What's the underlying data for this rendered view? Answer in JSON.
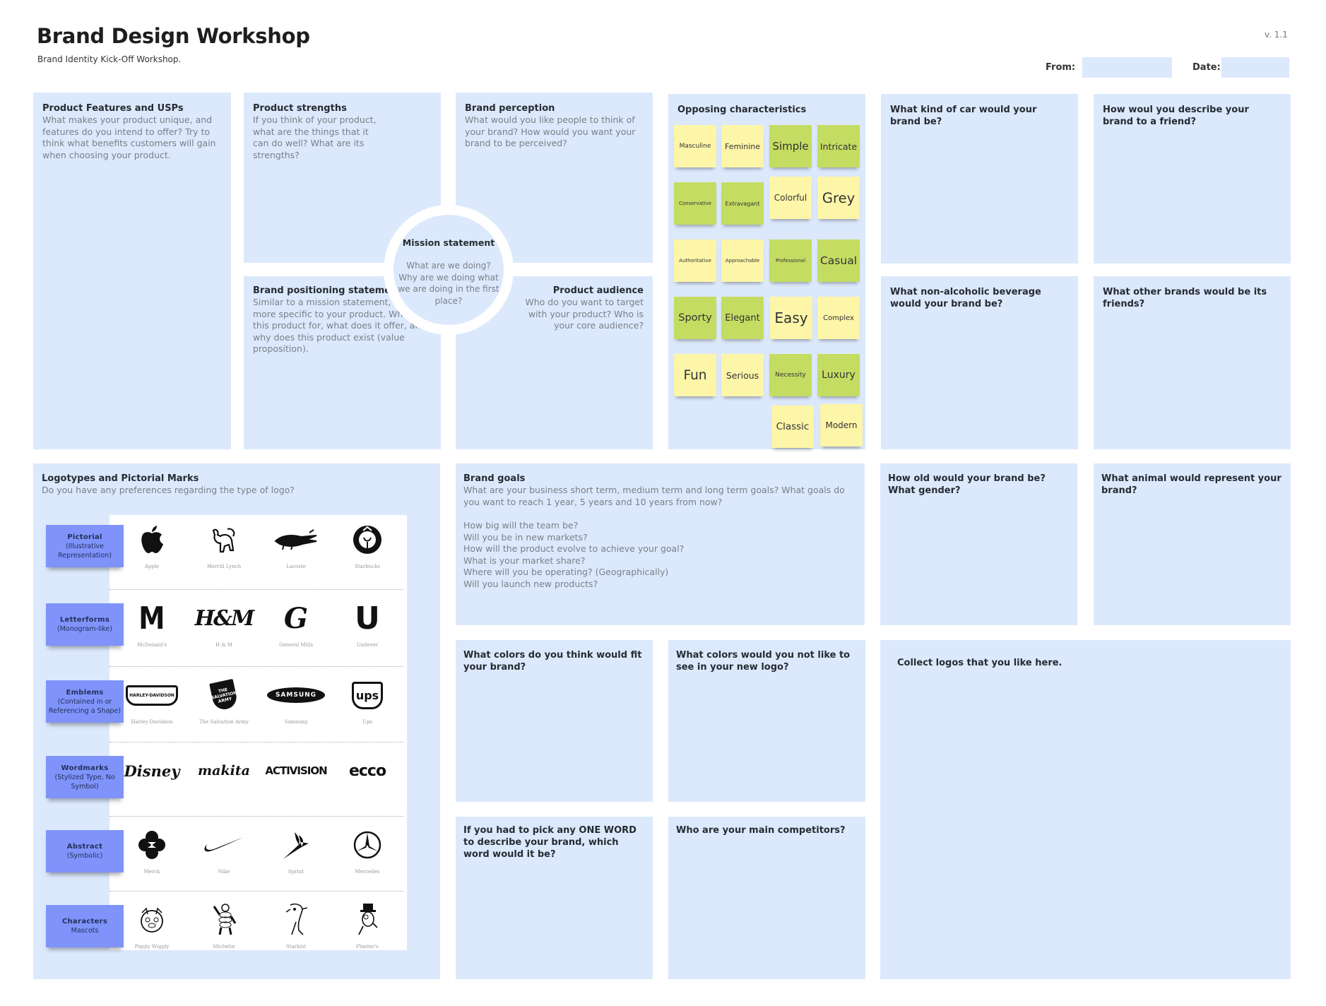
{
  "header": {
    "title": "Brand Design Workshop",
    "subtitle": "Brand Identity Kick-Off Workshop.",
    "version": "v. 1.1",
    "from_label": "From:",
    "from_value": "",
    "date_label": "Date:",
    "date_value": ""
  },
  "panels": {
    "features": {
      "title": "Product Features and USPs",
      "desc": "What makes your product unique, and features do you intend to offer? Try to think what benefits customers will gain when choosing your product."
    },
    "strengths": {
      "title": "Product strengths",
      "desc": "If you think of your product, what are the things that it can do well? What are its strengths?"
    },
    "perception": {
      "title": "Brand perception",
      "desc": "What would you like people to think of your brand? How would you want your brand to be perceived?"
    },
    "positioning": {
      "title": "Brand positioning statement",
      "desc": "Similar to a mission statement, but more specific to your product. Who is this product for, what does it offer, and why does this product exist (value proposition)."
    },
    "audience": {
      "title": "Product audience",
      "desc": "Who do you want to target with your product? Who is your core audience?"
    },
    "mission": {
      "title": "Mission statement",
      "desc": "What are we doing? Why are we doing what we are doing in the first place?"
    },
    "opposing": {
      "title": "Opposing characteristics"
    },
    "car": {
      "title": "What kind of car would your brand be?"
    },
    "describe": {
      "title": "How woul you describe your brand to a friend?"
    },
    "beverage": {
      "title": "What non-alcoholic beverage would your brand be?"
    },
    "friends": {
      "title": "What other brands would be its friends?"
    },
    "logotypes": {
      "title": "Logotypes and Pictorial Marks",
      "desc": "Do you have any preferences regarding the type of logo?"
    },
    "goals": {
      "title": "Brand goals",
      "desc": "What are your business short term, medium term and long term goals? What goals do you want to reach 1 year, 5 years and 10 years from now?",
      "questions": [
        "How big will the team be?",
        "Will you be in new markets?",
        "How will the product evolve to achieve your goal?",
        "What is your market share?",
        "Where will you be operating? (Geographically)",
        "Will you launch new products?"
      ]
    },
    "age": {
      "title": "How old would your brand be? What gender?"
    },
    "animal": {
      "title": "What animal would represent your brand?"
    },
    "colors_fit": {
      "title": "What colors do you think would fit your brand?"
    },
    "colors_not": {
      "title": "What colors would you not like to see in your new logo?"
    },
    "collect": {
      "title": "Collect logos that you like here."
    },
    "one_word": {
      "title": "If you had to pick any ONE WORD to describe your brand, which word would it be?"
    },
    "competitors": {
      "title": "Who are your main competitors?"
    }
  },
  "stickies": [
    {
      "label": "Masculine",
      "color": "yellow"
    },
    {
      "label": "Feminine",
      "color": "yellow"
    },
    {
      "label": "Simple",
      "color": "green"
    },
    {
      "label": "Intricate",
      "color": "green"
    },
    {
      "label": "Conservative",
      "color": "green"
    },
    {
      "label": "Extravagant",
      "color": "green"
    },
    {
      "label": "Colorful",
      "color": "yellow"
    },
    {
      "label": "Grey",
      "color": "yellow"
    },
    {
      "label": "Authoritative",
      "color": "yellow"
    },
    {
      "label": "Approachable",
      "color": "yellow"
    },
    {
      "label": "Professional",
      "color": "green"
    },
    {
      "label": "Casual",
      "color": "green"
    },
    {
      "label": "Sporty",
      "color": "green"
    },
    {
      "label": "Elegant",
      "color": "green"
    },
    {
      "label": "Easy",
      "color": "yellow"
    },
    {
      "label": "Complex",
      "color": "yellow"
    },
    {
      "label": "Fun",
      "color": "yellow"
    },
    {
      "label": "Serious",
      "color": "yellow"
    },
    {
      "label": "Necessity",
      "color": "green"
    },
    {
      "label": "Luxury",
      "color": "green"
    },
    {
      "label": "Classic",
      "color": "yellow"
    },
    {
      "label": "Modern",
      "color": "yellow"
    }
  ],
  "logo_categories": [
    {
      "name": "Pictorial",
      "sub": "(Illustrative Representation)",
      "logos": [
        {
          "name": "Apple",
          "icon": "apple-logo"
        },
        {
          "name": "Merrill Lynch",
          "icon": "bull-logo"
        },
        {
          "name": "Lacoste",
          "icon": "crocodile-logo"
        },
        {
          "name": "Starbucks",
          "icon": "siren-logo"
        }
      ]
    },
    {
      "name": "Letterforms",
      "sub": "(Monogram-like)",
      "logos": [
        {
          "name": "McDonald's",
          "icon": "golden-arches-logo",
          "glyph": "M"
        },
        {
          "name": "H & M",
          "icon": "hm-logo",
          "glyph": "H&M"
        },
        {
          "name": "General Mills",
          "icon": "g-logo",
          "glyph": "G"
        },
        {
          "name": "Unilever",
          "icon": "u-logo",
          "glyph": "U"
        }
      ]
    },
    {
      "name": "Emblems",
      "sub": "(Contained in or Referencing a Shape)",
      "logos": [
        {
          "name": "Harley-Davidson",
          "icon": "harley-shield-logo",
          "glyph": "HARLEY-DAVIDSON"
        },
        {
          "name": "The Salvation Army",
          "icon": "salvation-shield-logo",
          "glyph": "THE SALVATION ARMY"
        },
        {
          "name": "Samsung",
          "icon": "samsung-ellipse-logo",
          "glyph": "SAMSUNG"
        },
        {
          "name": "Ups",
          "icon": "ups-shield-logo",
          "glyph": "ups"
        }
      ]
    },
    {
      "name": "Wordmarks",
      "sub": "(Stylized Type, No Symbol)",
      "logos": [
        {
          "name": "",
          "icon": "disney-wordmark",
          "glyph": "Disney"
        },
        {
          "name": "",
          "icon": "makita-wordmark",
          "glyph": "makita"
        },
        {
          "name": "",
          "icon": "activision-wordmark",
          "glyph": "ACTIVISION"
        },
        {
          "name": "",
          "icon": "ecco-wordmark",
          "glyph": "ecco"
        }
      ]
    },
    {
      "name": "Abstract",
      "sub": "(Symbolic)",
      "logos": [
        {
          "name": "Merck",
          "icon": "merck-logo"
        },
        {
          "name": "Nike",
          "icon": "swoosh-logo"
        },
        {
          "name": "Sprint",
          "icon": "sprint-logo"
        },
        {
          "name": "Mercedes",
          "icon": "mercedes-star-logo"
        }
      ]
    },
    {
      "name": "Characters",
      "sub": "Mascots",
      "logos": [
        {
          "name": "Piggly Wiggly",
          "icon": "pig-mascot"
        },
        {
          "name": "Michelin",
          "icon": "michelin-man-mascot"
        },
        {
          "name": "Starkist",
          "icon": "tuna-mascot"
        },
        {
          "name": "Planter's",
          "icon": "peanut-mascot"
        }
      ]
    }
  ]
}
